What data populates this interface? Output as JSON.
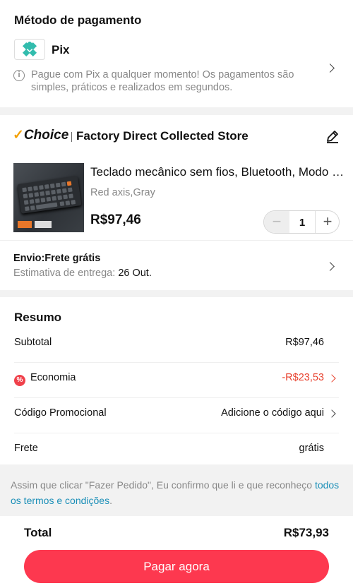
{
  "payment": {
    "title": "Método de pagamento",
    "method": "Pix",
    "info": "Pague com Pix a qualquer momento! Os pagamentos são simples, práticos e realizados em segundos.",
    "pix_color": "#32bcad"
  },
  "store": {
    "badge": "Choice",
    "name": "Factory Direct Collected Store",
    "product": {
      "title": "Teclado mecânico sem fios, Bluetooth, Modo triplo",
      "variant": "Red axis,Gray",
      "price": "R$97,46",
      "quantity": "1"
    },
    "shipping": {
      "title": "Envio:Frete grátis",
      "estimate_label": "Estimativa de entrega:",
      "estimate_date": "26 Out."
    }
  },
  "summary": {
    "title": "Resumo",
    "rows": [
      {
        "label": "Subtotal",
        "value": "R$97,46"
      },
      {
        "label": "Economia",
        "value": "-R$23,53"
      },
      {
        "label": "Código Promocional",
        "value": "Adicione o código aqui"
      },
      {
        "label": "Frete",
        "value": "grátis"
      }
    ]
  },
  "terms": {
    "text": "Assim que clicar \"Fazer Pedido\", Eu confirmo que li e que reconheço ",
    "link": "todos os termos e condições",
    "suffix": "."
  },
  "footer": {
    "total_label": "Total",
    "total_value": "R$73,93",
    "pay_button": "Pagar agora",
    "accent": "#fd384f"
  }
}
